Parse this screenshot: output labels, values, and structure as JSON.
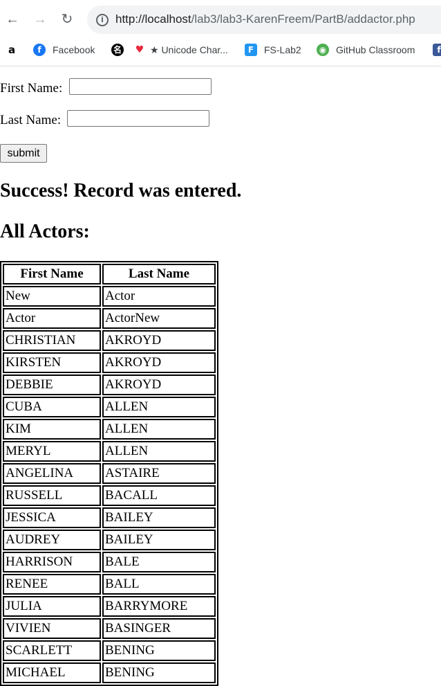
{
  "browser": {
    "url_host": "http://localhost",
    "url_path": "/lab3/lab3-KarenFreem/PartB/addactor.php",
    "bookmarks": [
      {
        "icon": "amazon-icon",
        "label": ""
      },
      {
        "icon": "facebook-icon",
        "label": "Facebook"
      },
      {
        "icon": "bookmark-icon",
        "label": ""
      },
      {
        "icon": "heart-icon",
        "label": "★ Unicode Char..."
      },
      {
        "icon": "fs-icon",
        "label": "FS-Lab2"
      },
      {
        "icon": "github-icon",
        "label": "GitHub Classroom"
      },
      {
        "icon": "bookmark-icon",
        "label": ""
      }
    ]
  },
  "form": {
    "first_name_label": "First Name:",
    "first_name_value": "",
    "last_name_label": "Last Name:",
    "last_name_value": "",
    "submit_label": "submit"
  },
  "message": "Success! Record was entered.",
  "list_heading": "All Actors:",
  "table": {
    "headers": [
      "First Name",
      "Last Name"
    ],
    "rows": [
      [
        "New",
        "Actor"
      ],
      [
        "Actor",
        "ActorNew"
      ],
      [
        "CHRISTIAN",
        "AKROYD"
      ],
      [
        "KIRSTEN",
        "AKROYD"
      ],
      [
        "DEBBIE",
        "AKROYD"
      ],
      [
        "CUBA",
        "ALLEN"
      ],
      [
        "KIM",
        "ALLEN"
      ],
      [
        "MERYL",
        "ALLEN"
      ],
      [
        "ANGELINA",
        "ASTAIRE"
      ],
      [
        "RUSSELL",
        "BACALL"
      ],
      [
        "JESSICA",
        "BAILEY"
      ],
      [
        "AUDREY",
        "BAILEY"
      ],
      [
        "HARRISON",
        "BALE"
      ],
      [
        "RENEE",
        "BALL"
      ],
      [
        "JULIA",
        "BARRYMORE"
      ],
      [
        "VIVIEN",
        "BASINGER"
      ],
      [
        "SCARLETT",
        "BENING"
      ],
      [
        "MICHAEL",
        "BENING"
      ]
    ]
  }
}
